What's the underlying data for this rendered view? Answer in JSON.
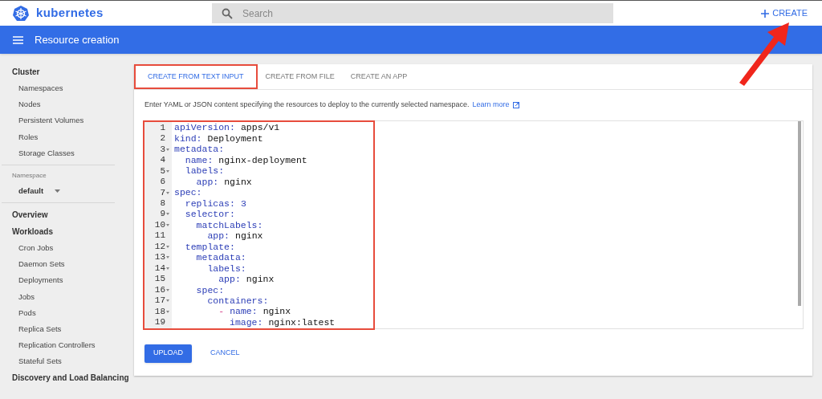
{
  "header": {
    "logo": "kubernetes",
    "search": {
      "placeholder": "Search"
    },
    "create_button": "CREATE"
  },
  "toolbar": {
    "title": "Resource creation"
  },
  "sidebar": [
    {
      "kind": "heading",
      "label": "Cluster"
    },
    {
      "kind": "item",
      "label": "Namespaces"
    },
    {
      "kind": "item",
      "label": "Nodes"
    },
    {
      "kind": "item",
      "label": "Persistent Volumes"
    },
    {
      "kind": "item",
      "label": "Roles"
    },
    {
      "kind": "item",
      "label": "Storage Classes"
    },
    {
      "kind": "divider"
    },
    {
      "kind": "caption",
      "label": "Namespace"
    },
    {
      "kind": "select",
      "label": "default"
    },
    {
      "kind": "divider"
    },
    {
      "kind": "heading",
      "label": "Overview"
    },
    {
      "kind": "heading",
      "label": "Workloads"
    },
    {
      "kind": "item",
      "label": "Cron Jobs"
    },
    {
      "kind": "item",
      "label": "Daemon Sets"
    },
    {
      "kind": "item",
      "label": "Deployments"
    },
    {
      "kind": "item",
      "label": "Jobs"
    },
    {
      "kind": "item",
      "label": "Pods"
    },
    {
      "kind": "item",
      "label": "Replica Sets"
    },
    {
      "kind": "item",
      "label": "Replication Controllers"
    },
    {
      "kind": "item",
      "label": "Stateful Sets"
    },
    {
      "kind": "heading",
      "label": "Discovery and Load Balancing"
    }
  ],
  "tabs": [
    {
      "label": "CREATE FROM TEXT INPUT",
      "selected": true
    },
    {
      "label": "CREATE FROM FILE",
      "selected": false
    },
    {
      "label": "CREATE AN APP",
      "selected": false
    }
  ],
  "description": "Enter YAML or JSON content specifying the resources to deploy to the currently selected namespace.",
  "learn_more": "Learn more",
  "editor": {
    "lines": [
      {
        "number": "1",
        "fold": false,
        "kind": "string",
        "key": "apiVersion:",
        "value": "apps/v1"
      },
      {
        "number": "2",
        "fold": false,
        "kind": "string",
        "key": "kind:",
        "value": "Deployment"
      },
      {
        "number": "3",
        "fold": true,
        "kind": "mapping",
        "key": "metadata:"
      },
      {
        "number": "4",
        "fold": false,
        "kind": "string",
        "key": "  name:",
        "value": "nginx-deployment"
      },
      {
        "number": "5",
        "fold": true,
        "kind": "mapping",
        "key": "  labels:"
      },
      {
        "number": "6",
        "fold": false,
        "kind": "string",
        "key": "    app:",
        "value": "nginx"
      },
      {
        "number": "7",
        "fold": true,
        "kind": "mapping",
        "key": "spec:"
      },
      {
        "number": "8",
        "fold": false,
        "kind": "number",
        "key": "  replicas:",
        "value": "3"
      },
      {
        "number": "9",
        "fold": true,
        "kind": "mapping",
        "key": "  selector:"
      },
      {
        "number": "10",
        "fold": true,
        "kind": "mapping",
        "key": "    matchLabels:"
      },
      {
        "number": "11",
        "fold": false,
        "kind": "string",
        "key": "      app:",
        "value": "nginx"
      },
      {
        "number": "12",
        "fold": true,
        "kind": "mapping",
        "key": "  template:"
      },
      {
        "number": "13",
        "fold": true,
        "kind": "mapping",
        "key": "    metadata:"
      },
      {
        "number": "14",
        "fold": true,
        "kind": "mapping",
        "key": "      labels:"
      },
      {
        "number": "15",
        "fold": false,
        "kind": "string",
        "key": "        app:",
        "value": "nginx"
      },
      {
        "number": "16",
        "fold": true,
        "kind": "mapping",
        "key": "    spec:"
      },
      {
        "number": "17",
        "fold": true,
        "kind": "mapping",
        "key": "      containers:"
      },
      {
        "number": "18",
        "fold": true,
        "kind": "string",
        "dash": "        -",
        "key": "name:",
        "value": "nginx"
      },
      {
        "number": "19",
        "fold": false,
        "kind": "string",
        "key": "          image:",
        "value": "nginx:latest"
      }
    ]
  },
  "actions": {
    "upload": "UPLOAD",
    "cancel": "CANCEL"
  }
}
